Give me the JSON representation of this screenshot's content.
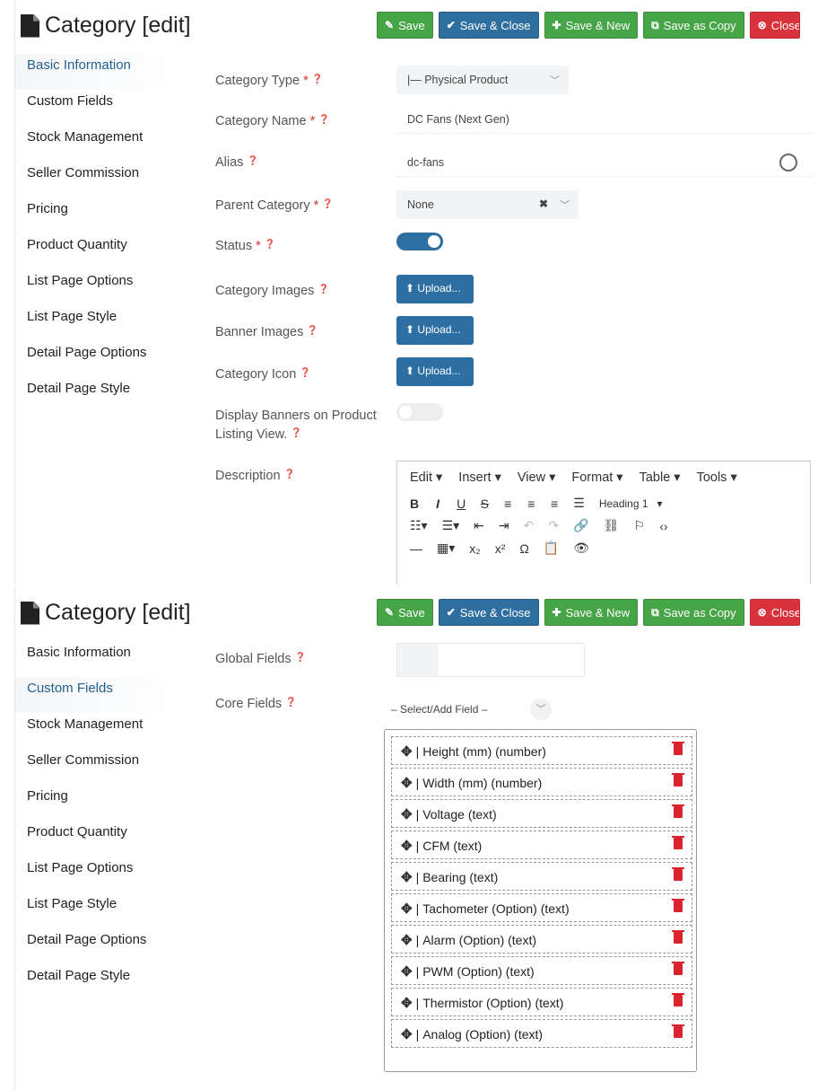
{
  "title": "Category [edit]",
  "toolbar": {
    "save": "Save",
    "save_close": "Save & Close",
    "save_new": "Save & New",
    "save_copy": "Save as Copy",
    "close": "Close"
  },
  "sidebar": [
    "Basic Information",
    "Custom Fields",
    "Stock Management",
    "Seller Commission",
    "Pricing",
    "Product Quantity",
    "List Page Options",
    "List Page Style",
    "Detail Page Options",
    "Detail Page Style"
  ],
  "basic": {
    "category_type_label": "Category Type",
    "category_type_value": "|— Physical Product",
    "category_name_label": "Category Name",
    "category_name_value": "DC Fans (Next Gen)",
    "alias_label": "Alias",
    "alias_value": "dc-fans",
    "parent_label": "Parent Category",
    "parent_value": "None",
    "status_label": "Status",
    "status_on": true,
    "images_label": "Category Images",
    "banner_label": "Banner Images",
    "icon_label": "Category Icon",
    "upload_label": "Upload...",
    "display_banners_label": "Display Banners on Product Listing View.",
    "display_banners_on": false,
    "description_label": "Description",
    "required_mark": "*"
  },
  "editor": {
    "menus": [
      "Edit ▾",
      "Insert ▾",
      "View ▾",
      "Format ▾",
      "Table ▾",
      "Tools ▾"
    ],
    "heading": "Heading 1"
  },
  "custom": {
    "global_label": "Global Fields",
    "core_label": "Core Fields",
    "select_placeholder": "– Select/Add Field –",
    "fields": [
      "Height (mm) (number)",
      "Width (mm) (number)",
      "Voltage (text)",
      "CFM (text)",
      "Bearing (text)",
      "Tachometer (Option) (text)",
      "Alarm (Option) (text)",
      "PWM (Option) (text)",
      "Thermistor (Option) (text)",
      "Analog (Option) (text)"
    ]
  }
}
